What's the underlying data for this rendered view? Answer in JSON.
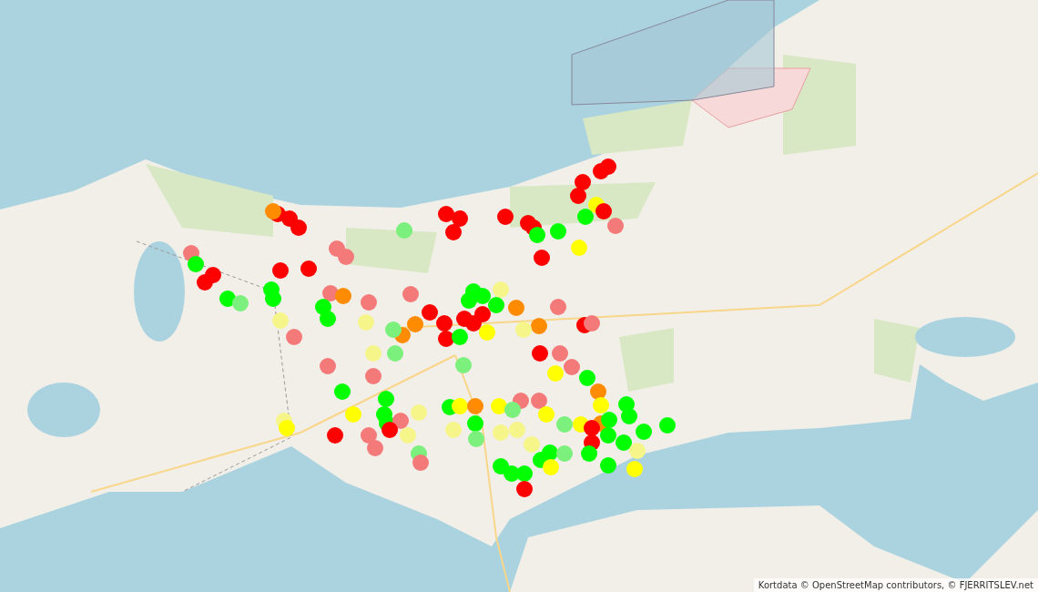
{
  "map": {
    "markers": [
      {
        "color": "#ff0000"
      },
      {
        "color": "#ff0000"
      },
      {
        "color": "#ff0000"
      },
      {
        "color": "#ff8c00"
      },
      {
        "color": "#ff0000"
      },
      {
        "color": "#ff0000"
      },
      {
        "color": "#ff0000"
      },
      {
        "color": "#ff0000"
      },
      {
        "color": "#ff0000"
      },
      {
        "color": "#ff0000"
      },
      {
        "color": "#00ff00"
      },
      {
        "color": "#ff0000"
      },
      {
        "color": "#ff0000"
      },
      {
        "color": "#ff0000"
      },
      {
        "color": "#ff0000"
      },
      {
        "color": "#ffff00"
      },
      {
        "color": "#ff0000"
      },
      {
        "color": "#f47a7a"
      },
      {
        "color": "#00ff00"
      },
      {
        "color": "#7cf07c"
      },
      {
        "color": "#00ff00"
      },
      {
        "color": "#ffff00"
      },
      {
        "color": "#ff0000"
      },
      {
        "color": "#f47a7a"
      },
      {
        "color": "#f47a7a"
      },
      {
        "color": "#f47a7a"
      },
      {
        "color": "#00ff00"
      },
      {
        "color": "#ff0000"
      },
      {
        "color": "#ff0000"
      },
      {
        "color": "#ff0000"
      },
      {
        "color": "#00ff00"
      },
      {
        "color": "#00ff00"
      },
      {
        "color": "#00ff00"
      },
      {
        "color": "#7cf07c"
      },
      {
        "color": "#ff0000"
      },
      {
        "color": "#00ff00"
      },
      {
        "color": "#00ff00"
      },
      {
        "color": "#00ff00"
      },
      {
        "color": "#f5f58a"
      },
      {
        "color": "#00ff00"
      },
      {
        "color": "#ff8c00"
      },
      {
        "color": "#f47a7a"
      },
      {
        "color": "#f47a7a"
      },
      {
        "color": "#ff8c00"
      },
      {
        "color": "#00ff00"
      },
      {
        "color": "#00ff00"
      },
      {
        "color": "#f47a7a"
      },
      {
        "color": "#f47a7a"
      },
      {
        "color": "#ff0000"
      },
      {
        "color": "#ff0000"
      },
      {
        "color": "#ff0000"
      },
      {
        "color": "#ff0000"
      },
      {
        "color": "#ff0000"
      },
      {
        "color": "#ff0000"
      },
      {
        "color": "#00ff00"
      },
      {
        "color": "#ffff00"
      },
      {
        "color": "#ff8c00"
      },
      {
        "color": "#ff8c00"
      },
      {
        "color": "#7cf07c"
      },
      {
        "color": "#ff8c00"
      },
      {
        "color": "#f5f58a"
      },
      {
        "color": "#ff0000"
      },
      {
        "color": "#f47a7a"
      },
      {
        "color": "#f47a7a"
      },
      {
        "color": "#f5f58a"
      },
      {
        "color": "#f5f58a"
      },
      {
        "color": "#f5f58a"
      },
      {
        "color": "#7cf07c"
      },
      {
        "color": "#f47a7a"
      },
      {
        "color": "#f47a7a"
      },
      {
        "color": "#7cf07c"
      },
      {
        "color": "#ff0000"
      },
      {
        "color": "#f47a7a"
      },
      {
        "color": "#f47a7a"
      },
      {
        "color": "#ffff00"
      },
      {
        "color": "#00ff00"
      },
      {
        "color": "#ff8c00"
      },
      {
        "color": "#ffff00"
      },
      {
        "color": "#00ff00"
      },
      {
        "color": "#00ff00"
      },
      {
        "color": "#00ff00"
      },
      {
        "color": "#00ff00"
      },
      {
        "color": "#00ff00"
      },
      {
        "color": "#f47a7a"
      },
      {
        "color": "#ffff00"
      },
      {
        "color": "#f5f58a"
      },
      {
        "color": "#ffff00"
      },
      {
        "color": "#ff0000"
      },
      {
        "color": "#f47a7a"
      },
      {
        "color": "#f47a7a"
      },
      {
        "color": "#ff0000"
      },
      {
        "color": "#f5f58a"
      },
      {
        "color": "#f5f58a"
      },
      {
        "color": "#00ff00"
      },
      {
        "color": "#ffff00"
      },
      {
        "color": "#ff8c00"
      },
      {
        "color": "#ffff00"
      },
      {
        "color": "#f47a7a"
      },
      {
        "color": "#f47a7a"
      },
      {
        "color": "#7cf07c"
      },
      {
        "color": "#ffff00"
      },
      {
        "color": "#00ff00"
      },
      {
        "color": "#7cf07c"
      },
      {
        "color": "#f5f58a"
      },
      {
        "color": "#f5f58a"
      },
      {
        "color": "#f5f58a"
      },
      {
        "color": "#7cf07c"
      },
      {
        "color": "#ffff00"
      },
      {
        "color": "#ff8c00"
      },
      {
        "color": "#ff0000"
      },
      {
        "color": "#00ff00"
      },
      {
        "color": "#00ff00"
      },
      {
        "color": "#00ff00"
      },
      {
        "color": "#00ff00"
      },
      {
        "color": "#ff0000"
      },
      {
        "color": "#00ff00"
      },
      {
        "color": "#f5f58a"
      },
      {
        "color": "#00ff00"
      },
      {
        "color": "#7cf07c"
      },
      {
        "color": "#f47a7a"
      },
      {
        "color": "#f5f58a"
      },
      {
        "color": "#00ff00"
      },
      {
        "color": "#00ff00"
      },
      {
        "color": "#7cf07c"
      },
      {
        "color": "#00ff00"
      },
      {
        "color": "#00ff00"
      },
      {
        "color": "#ffff00"
      },
      {
        "color": "#00ff00"
      },
      {
        "color": "#00ff00"
      },
      {
        "color": "#00ff00"
      },
      {
        "color": "#ffff00"
      },
      {
        "color": "#ff0000"
      }
    ]
  },
  "attribution": "Kortdata © OpenStreetMap contributors, © FJERRITSLEV.net"
}
